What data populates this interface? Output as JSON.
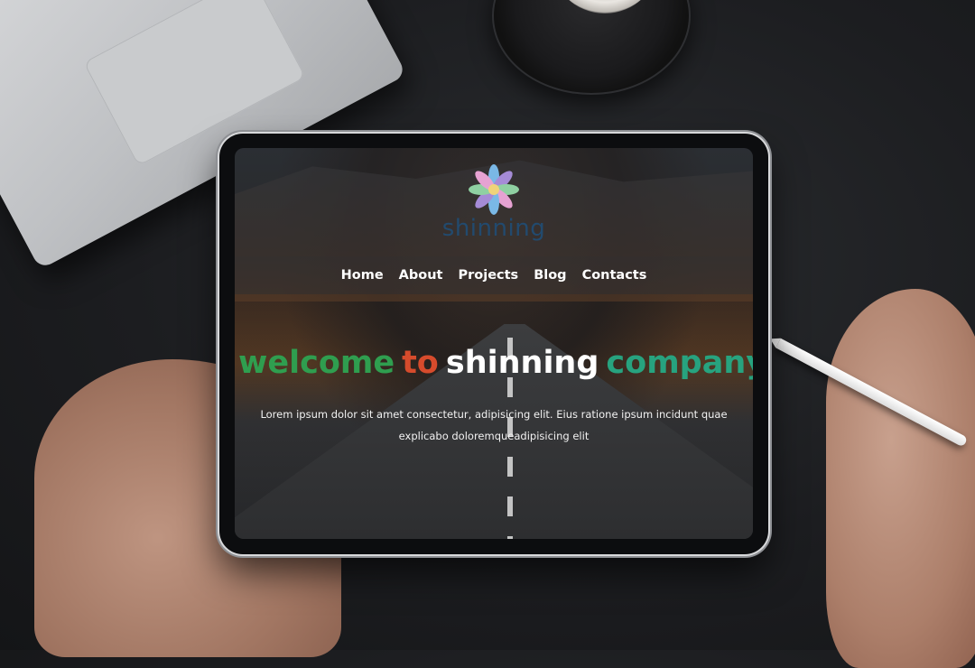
{
  "site": {
    "brand_name": "shinning",
    "nav": [
      "Home",
      "About",
      "Projects",
      "Blog",
      "Contacts"
    ],
    "hero": {
      "words": [
        {
          "text": "welcome",
          "color": "#2f9e4f"
        },
        {
          "text": "to",
          "color": "#d64b2c"
        },
        {
          "text": "shinning",
          "color": "#ffffff"
        },
        {
          "text": "company",
          "color": "#27a37f"
        }
      ],
      "paragraph": "Lorem ipsum dolor sit amet consectetur, adipisicing elit. Eius ratione ipsum incidunt quae explicabo doloremqueadipisicing elit"
    }
  },
  "colors": {
    "brand_text": "#1f4f7a",
    "nav_text": "#ffffff",
    "petals": [
      "#7ab8e6",
      "#a58bd6",
      "#e6a2d2",
      "#8fd0a2",
      "#f0d37a"
    ]
  },
  "icons": {
    "logo": "flower-logo-icon"
  }
}
